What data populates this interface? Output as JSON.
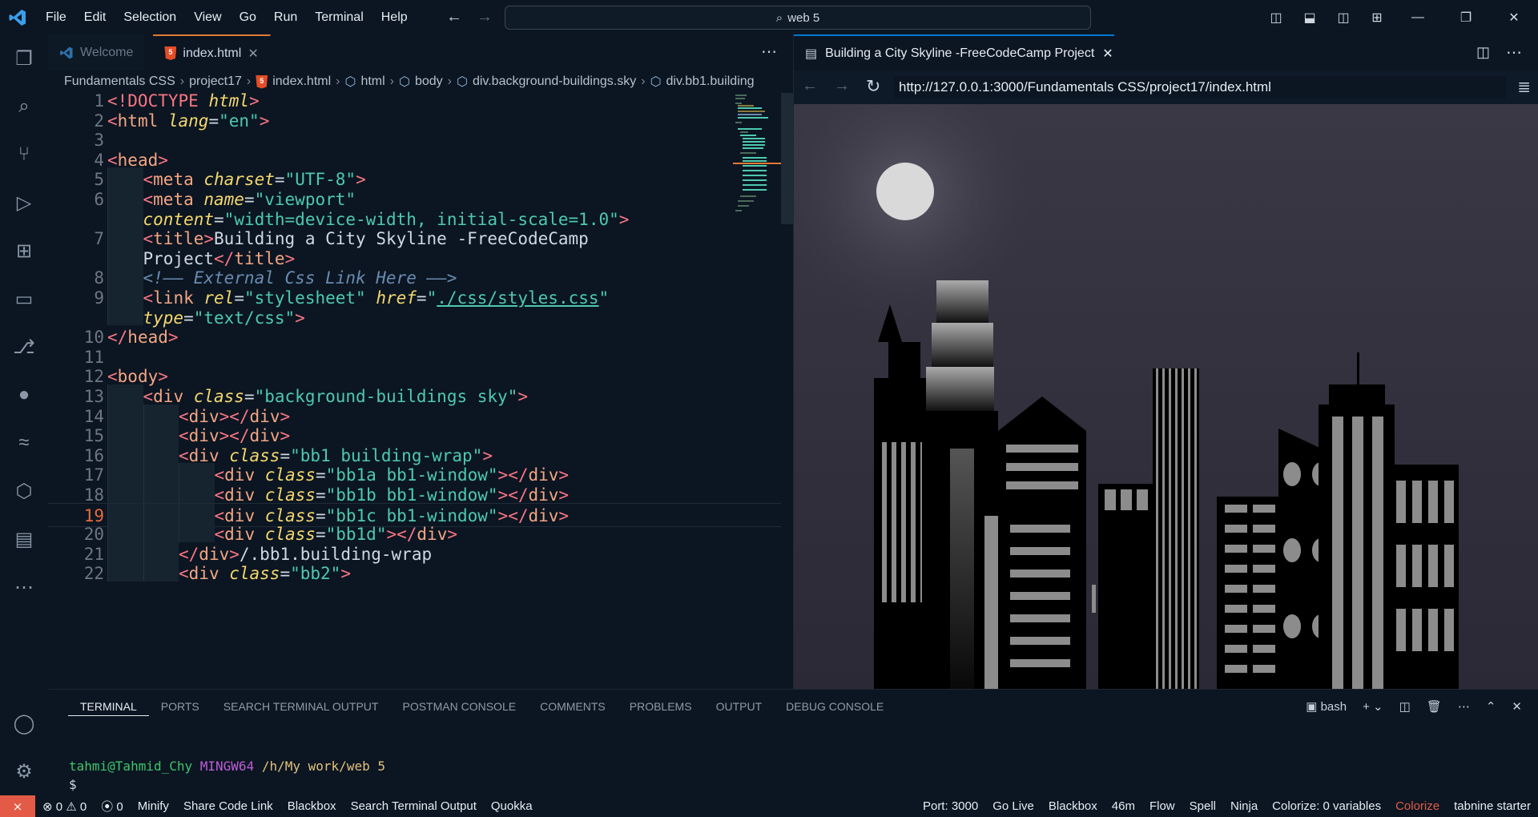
{
  "titlebar": {
    "menu": [
      "File",
      "Edit",
      "Selection",
      "View",
      "Go",
      "Run",
      "Terminal",
      "Help"
    ],
    "search_text": "web 5"
  },
  "editor": {
    "tabs": [
      {
        "label": "Welcome",
        "active": false
      },
      {
        "label": "index.html",
        "active": true
      }
    ],
    "breadcrumb": [
      "Fundamentals CSS",
      "project17",
      "index.html",
      "html",
      "body",
      "div.background-buildings.sky",
      "div.bb1.building"
    ],
    "current_line": 19,
    "lines": [
      {
        "n": "1",
        "indent": 0,
        "parts": [
          [
            "t",
            "<!DOCTYPE "
          ],
          [
            "a",
            "html"
          ],
          [
            "t",
            ">"
          ]
        ]
      },
      {
        "n": "2",
        "indent": 0,
        "parts": [
          [
            "t",
            "<"
          ],
          [
            "tn",
            "html "
          ],
          [
            "a",
            "lang"
          ],
          [
            "p",
            "="
          ],
          [
            "s",
            "\"en\""
          ],
          [
            "t",
            ">"
          ]
        ]
      },
      {
        "n": "3",
        "indent": 0,
        "parts": []
      },
      {
        "n": "4",
        "indent": 0,
        "parts": [
          [
            "t",
            "<"
          ],
          [
            "tn",
            "head"
          ],
          [
            "t",
            ">"
          ]
        ]
      },
      {
        "n": "5",
        "indent": 1,
        "parts": [
          [
            "t",
            "<"
          ],
          [
            "tn",
            "meta "
          ],
          [
            "a",
            "charset"
          ],
          [
            "p",
            "="
          ],
          [
            "s",
            "\"UTF-8\""
          ],
          [
            "t",
            ">"
          ]
        ]
      },
      {
        "n": "6",
        "indent": 1,
        "parts": [
          [
            "t",
            "<"
          ],
          [
            "tn",
            "meta "
          ],
          [
            "a",
            "name"
          ],
          [
            "p",
            "="
          ],
          [
            "s",
            "\"viewport\""
          ]
        ]
      },
      {
        "n": "",
        "indent": 1,
        "parts": [
          [
            "a",
            "content"
          ],
          [
            "p",
            "="
          ],
          [
            "s",
            "\"width=device-width, initial-scale=1.0\""
          ],
          [
            "t",
            ">"
          ]
        ]
      },
      {
        "n": "7",
        "indent": 1,
        "parts": [
          [
            "t",
            "<"
          ],
          [
            "tn",
            "title"
          ],
          [
            "t",
            ">"
          ],
          [
            "p",
            "Building a City Skyline -FreeCodeCamp"
          ]
        ]
      },
      {
        "n": "",
        "indent": 1,
        "parts": [
          [
            "p",
            "Project"
          ],
          [
            "t",
            "</"
          ],
          [
            "tn",
            "title"
          ],
          [
            "t",
            ">"
          ]
        ]
      },
      {
        "n": "8",
        "indent": 1,
        "parts": [
          [
            "c",
            "<!—— External Css Link Here ——>"
          ]
        ]
      },
      {
        "n": "9",
        "indent": 1,
        "parts": [
          [
            "t",
            "<"
          ],
          [
            "tn",
            "link "
          ],
          [
            "a",
            "rel"
          ],
          [
            "p",
            "="
          ],
          [
            "s",
            "\"stylesheet\" "
          ],
          [
            "a",
            "href"
          ],
          [
            "p",
            "="
          ],
          [
            "s",
            "\""
          ],
          [
            "lnk",
            "./css/styles.css"
          ],
          [
            "s",
            "\""
          ]
        ]
      },
      {
        "n": "",
        "indent": 1,
        "parts": [
          [
            "a",
            "type"
          ],
          [
            "p",
            "="
          ],
          [
            "s",
            "\"text/css\""
          ],
          [
            "t",
            ">"
          ]
        ]
      },
      {
        "n": "10",
        "indent": 0,
        "parts": [
          [
            "t",
            "</"
          ],
          [
            "tn",
            "head"
          ],
          [
            "t",
            ">"
          ]
        ]
      },
      {
        "n": "11",
        "indent": 0,
        "parts": []
      },
      {
        "n": "12",
        "indent": 0,
        "parts": [
          [
            "t",
            "<"
          ],
          [
            "tn",
            "body"
          ],
          [
            "t",
            ">"
          ]
        ]
      },
      {
        "n": "13",
        "indent": 1,
        "parts": [
          [
            "t",
            "<"
          ],
          [
            "tn",
            "div "
          ],
          [
            "a",
            "class"
          ],
          [
            "p",
            "="
          ],
          [
            "s",
            "\"background-buildings sky\""
          ],
          [
            "t",
            ">"
          ]
        ]
      },
      {
        "n": "14",
        "indent": 2,
        "parts": [
          [
            "t",
            "<"
          ],
          [
            "tn",
            "div"
          ],
          [
            "t",
            "></"
          ],
          [
            "tn",
            "div"
          ],
          [
            "t",
            ">"
          ]
        ]
      },
      {
        "n": "15",
        "indent": 2,
        "parts": [
          [
            "t",
            "<"
          ],
          [
            "tn",
            "div"
          ],
          [
            "t",
            "></"
          ],
          [
            "tn",
            "div"
          ],
          [
            "t",
            ">"
          ]
        ]
      },
      {
        "n": "16",
        "indent": 2,
        "parts": [
          [
            "t",
            "<"
          ],
          [
            "tn",
            "div "
          ],
          [
            "a",
            "class"
          ],
          [
            "p",
            "="
          ],
          [
            "s",
            "\"bb1 building-wrap\""
          ],
          [
            "t",
            ">"
          ]
        ]
      },
      {
        "n": "17",
        "indent": 3,
        "parts": [
          [
            "t",
            "<"
          ],
          [
            "tn",
            "div "
          ],
          [
            "a",
            "class"
          ],
          [
            "p",
            "="
          ],
          [
            "s",
            "\"bb1a bb1-window\""
          ],
          [
            "t",
            "></"
          ],
          [
            "tn",
            "div"
          ],
          [
            "t",
            ">"
          ]
        ]
      },
      {
        "n": "18",
        "indent": 3,
        "parts": [
          [
            "t",
            "<"
          ],
          [
            "tn",
            "div "
          ],
          [
            "a",
            "class"
          ],
          [
            "p",
            "="
          ],
          [
            "s",
            "\"bb1b bb1-window\""
          ],
          [
            "t",
            "></"
          ],
          [
            "tn",
            "div"
          ],
          [
            "t",
            ">"
          ]
        ]
      },
      {
        "n": "19",
        "indent": 3,
        "parts": [
          [
            "t",
            "<"
          ],
          [
            "tn",
            "div "
          ],
          [
            "a",
            "class"
          ],
          [
            "p",
            "="
          ],
          [
            "s",
            "\"bb1c bb1-window\""
          ],
          [
            "t",
            "></"
          ],
          [
            "tn",
            "div"
          ],
          [
            "t",
            ">"
          ]
        ]
      },
      {
        "n": "20",
        "indent": 3,
        "parts": [
          [
            "t",
            "<"
          ],
          [
            "tn",
            "div "
          ],
          [
            "a",
            "class"
          ],
          [
            "p",
            "="
          ],
          [
            "s",
            "\"bb1d\""
          ],
          [
            "t",
            "></"
          ],
          [
            "tn",
            "div"
          ],
          [
            "t",
            ">"
          ]
        ]
      },
      {
        "n": "21",
        "indent": 2,
        "parts": [
          [
            "t",
            "</"
          ],
          [
            "tn",
            "div"
          ],
          [
            "t",
            ">"
          ],
          [
            "p",
            "/.bb1.building-wrap"
          ]
        ]
      },
      {
        "n": "22",
        "indent": 2,
        "parts": [
          [
            "t",
            "<"
          ],
          [
            "tn",
            "div "
          ],
          [
            "a",
            "class"
          ],
          [
            "p",
            "="
          ],
          [
            "s",
            "\"bb2\""
          ],
          [
            "t",
            ">"
          ]
        ]
      }
    ]
  },
  "browser": {
    "tab_title": "Building a City Skyline -FreeCodeCamp Project",
    "url": "http://127.0.0.1:3000/Fundamentals CSS/project17/index.html"
  },
  "panel": {
    "tabs": [
      "TERMINAL",
      "PORTS",
      "SEARCH TERMINAL OUTPUT",
      "POSTMAN CONSOLE",
      "COMMENTS",
      "PROBLEMS",
      "OUTPUT",
      "DEBUG CONSOLE"
    ],
    "shell": "bash",
    "prompt_user": "tahmi@Tahmid_Chy",
    "prompt_env": "MINGW64",
    "prompt_path": "/h/My work/web 5",
    "prompt_symbol": "$"
  },
  "status": {
    "errors": "0",
    "warnings": "0",
    "ports_count": "0",
    "left": [
      "Minify",
      "Share Code Link",
      "Blackbox",
      "Search Terminal Output",
      "Quokka"
    ],
    "right": [
      "Port: 3000",
      "Go Live",
      "Blackbox",
      "46m",
      "Flow",
      "Spell",
      "Ninja",
      "Colorize: 0 variables",
      "Colorize",
      "tabnine starter"
    ]
  },
  "colors": {
    "accent": "#e37933",
    "remote": "#e35b46",
    "string": "#4ec9b0",
    "tag": "#f97583",
    "attr": "#f5d76e"
  }
}
